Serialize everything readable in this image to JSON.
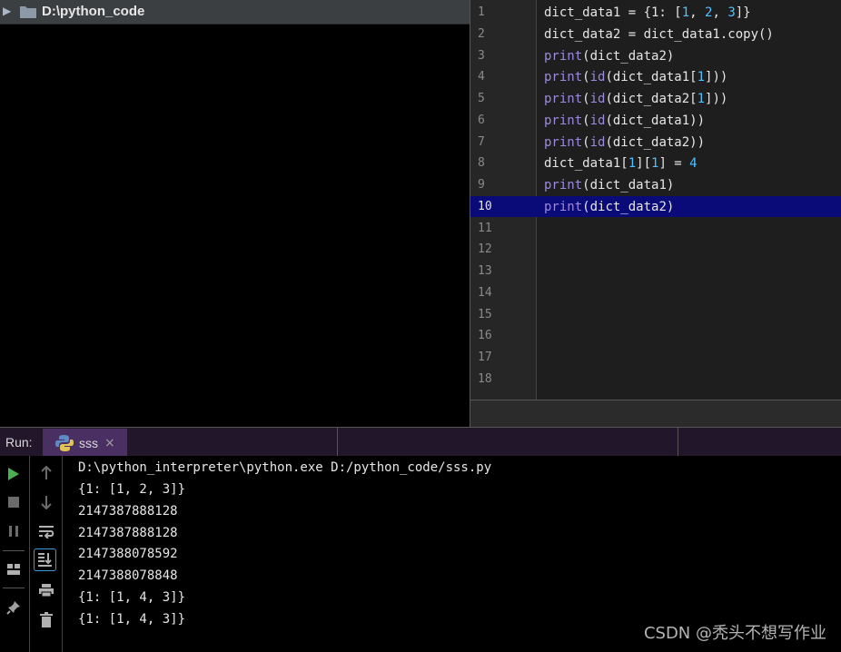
{
  "project": {
    "root_label": "D:\\python_code",
    "arrow_icon": "triangle-right-icon",
    "folder_icon": "folder-icon"
  },
  "editor": {
    "line_numbers": [
      "1",
      "2",
      "3",
      "4",
      "5",
      "6",
      "7",
      "8",
      "9",
      "10",
      "11",
      "12",
      "13",
      "14",
      "15",
      "16",
      "17",
      "18"
    ],
    "current_line": "10",
    "colors": {
      "keyword": "#9c8ade",
      "number": "#4fc1ff",
      "current_line_bg": "#0a0a78"
    }
  },
  "code_lines": [
    "dict_data1 = {1: [1, 2, 3]}",
    "dict_data2 = dict_data1.copy()",
    "print(dict_data2)",
    "print(id(dict_data1[1]))",
    "print(id(dict_data2[1]))",
    "print(id(dict_data1))",
    "print(id(dict_data2))",
    "dict_data1[1][1] = 4",
    "print(dict_data1)",
    "print(dict_data2)"
  ],
  "run": {
    "title": "Run:",
    "tab_label": "sss",
    "tab_close": "×",
    "console_lines": [
      "D:\\python_interpreter\\python.exe D:/python_code/sss.py",
      "{1: [1, 2, 3]}",
      "2147387888128",
      "2147387888128",
      "2147388078592",
      "2147388078848",
      "{1: [1, 4, 3]}",
      "{1: [1, 4, 3]}"
    ],
    "toolbar_left": [
      "play-icon",
      "stop-icon",
      "pause-icon",
      "layout-icon",
      "pin-icon"
    ],
    "toolbar_right": [
      "arrow-up-icon",
      "arrow-down-icon",
      "soft-wrap-icon",
      "scroll-to-end-icon",
      "print-icon",
      "trash-icon"
    ]
  },
  "watermark": "CSDN @秃头不想写作业"
}
